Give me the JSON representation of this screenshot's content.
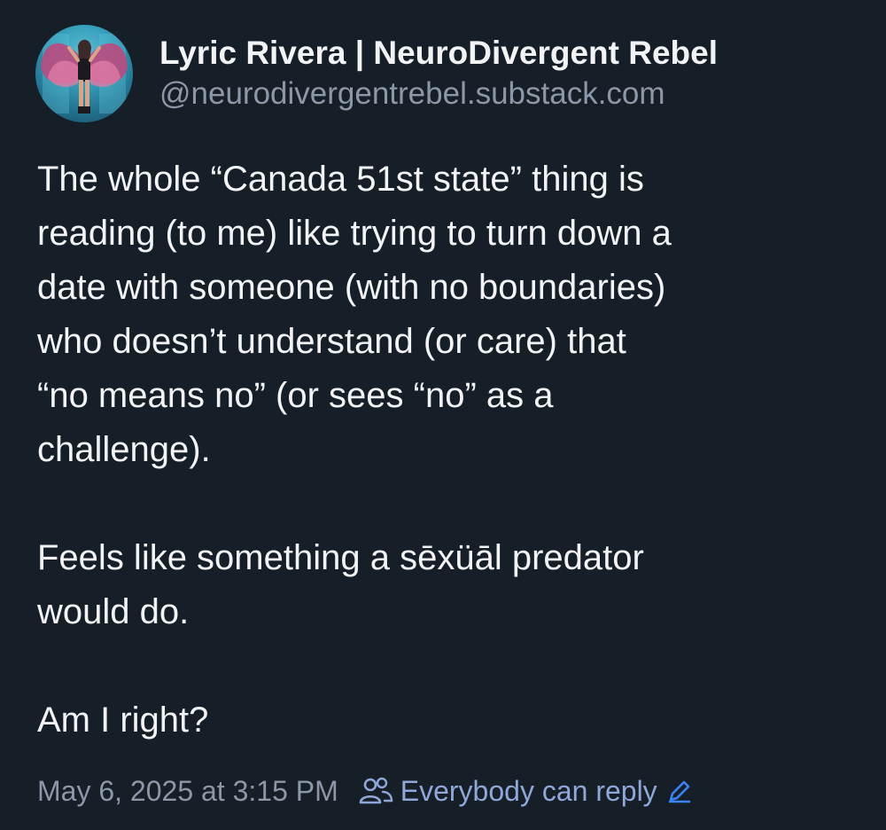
{
  "author": {
    "display_name": "Lyric Rivera | NeuroDivergent Rebel",
    "handle": "@neurodivergentrebel.substack.com",
    "avatar_icon": "profile-photo-winged-figure"
  },
  "post": {
    "paragraphs": [
      "The whole “Canada 51st state” thing is\nreading (to me) like trying to turn down a\ndate with someone (with no boundaries)\nwho doesn’t understand (or care) that\n“no means no” (or sees “no” as a\nchallenge).",
      "Feels like something a sēxüāl predator\nwould do.",
      "Am I right?"
    ]
  },
  "footer": {
    "timestamp": "May 6, 2025 at 3:15 PM",
    "reply_icon": "people-icon",
    "reply_setting": "Everybody can reply",
    "edit_icon": "pencil-icon"
  },
  "colors": {
    "background": "#161e27",
    "primary_text": "#f1f3f5",
    "secondary_text": "#8b98a8",
    "accent": "#8fa8d9"
  }
}
